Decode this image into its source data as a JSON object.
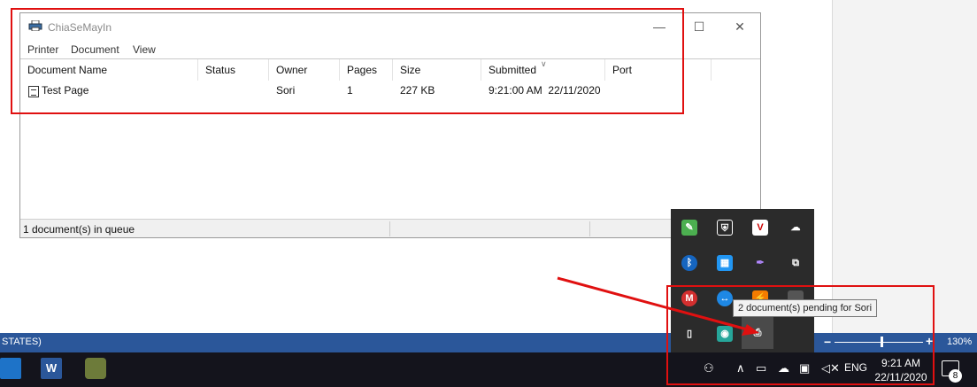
{
  "window": {
    "title": "ChiaSeMayIn",
    "controls": {
      "minimize": "—",
      "maximize": "☐",
      "close": "✕"
    },
    "menu": [
      "Printer",
      "Document",
      "View"
    ]
  },
  "columns": [
    "Document Name",
    "Status",
    "Owner",
    "Pages",
    "Size",
    "Submitted",
    "Port"
  ],
  "rows": [
    {
      "name": "Test Page",
      "status": "",
      "owner": "Sori",
      "pages": "1",
      "size": "227 KB",
      "submitted": "9:21:00 AM  22/11/2020",
      "port": ""
    }
  ],
  "status_bar": {
    "text": "1 document(s) in queue"
  },
  "word_status": {
    "language": "STATES)",
    "zoom_minus": "−",
    "zoom_plus": "+",
    "zoom": "130%",
    "zoom_level_fraction": 0.53
  },
  "tray": {
    "tooltip": "2 document(s) pending for Sori",
    "icons": [
      "leaf-icon",
      "shield-icon",
      "v-icon",
      "cloud-upload-icon",
      "bluetooth-icon",
      "monitor-icon",
      "feather-icon",
      "copy-icon",
      "m-icon",
      "teamviewer-icon",
      "orange-app-icon",
      "gray-box-icon",
      "usb-icon",
      "eye-icon",
      "printer-icon"
    ]
  },
  "taskbar": {
    "word_label": "W",
    "time": "9:21 AM",
    "date": "22/11/2020",
    "language": "ENG",
    "notification_count": "8"
  },
  "colors": {
    "accent": "#2b579a",
    "annotation": "#e01010",
    "taskbar": "#14141c",
    "tray": "#2b2b2b"
  }
}
